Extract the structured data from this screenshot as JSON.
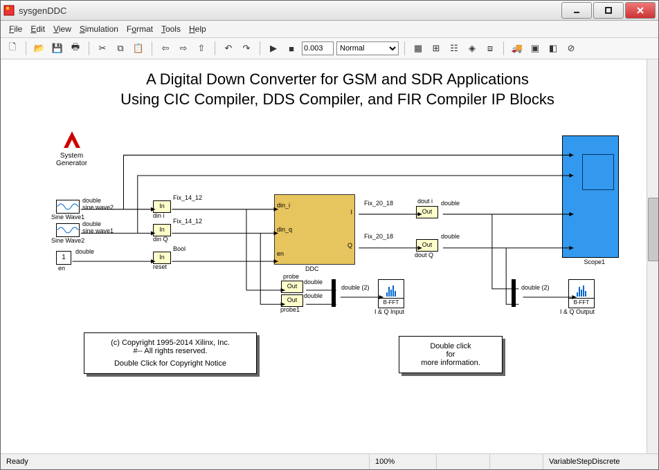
{
  "window": {
    "title": "sysgenDDC"
  },
  "menus": {
    "file": "File",
    "edit": "Edit",
    "view": "View",
    "sim": "Simulation",
    "format": "Format",
    "tools": "Tools",
    "help": "Help"
  },
  "toolbar": {
    "stoptime": "0.003",
    "mode": "Normal"
  },
  "title_lines": {
    "l1": "A Digital Down Converter for GSM and SDR Applications",
    "l2": "Using CIC Compiler, DDS Compiler, and FIR Compiler IP Blocks"
  },
  "labels": {
    "sysgen": "System\nGenerator",
    "double": "double",
    "sinewave": "sine wave2",
    "sw1": "Sine Wave1",
    "sinewave1": "sine wave1",
    "sw2": "Sine Wave2",
    "en": "en",
    "one": "1",
    "in": "In",
    "din_i": "din i",
    "din_q": "din Q",
    "reset": "reset",
    "fix1412": "Fix_14_12",
    "bool": "Bool",
    "ddc": "DDC",
    "ddc_din_i": "din_i",
    "ddc_din_q": "din_q",
    "ddc_en": "en",
    "ddc_I": "I",
    "ddc_Q": "Q",
    "fix2018": "Fix_20_18",
    "out": "Out",
    "douti": "dout i",
    "doutq": "dout Q",
    "scope": "Scope1",
    "probe": "probe",
    "probe1": "probe1",
    "double2": "double (2)",
    "bfft": "B-FFT",
    "iq_in": "I & Q Input",
    "iq_out": "I & Q Output"
  },
  "notes": {
    "copyright": {
      "l1": "(c) Copyright 1995-2014 Xilinx, Inc.",
      "l2": "#-- All rights reserved.",
      "l3": "Double Click for Copyright Notice"
    },
    "info": {
      "l1": "Double click",
      "l2": "for",
      "l3": "more information."
    }
  },
  "status": {
    "ready": "Ready",
    "zoom": "100%",
    "solver": "VariableStepDiscrete"
  }
}
